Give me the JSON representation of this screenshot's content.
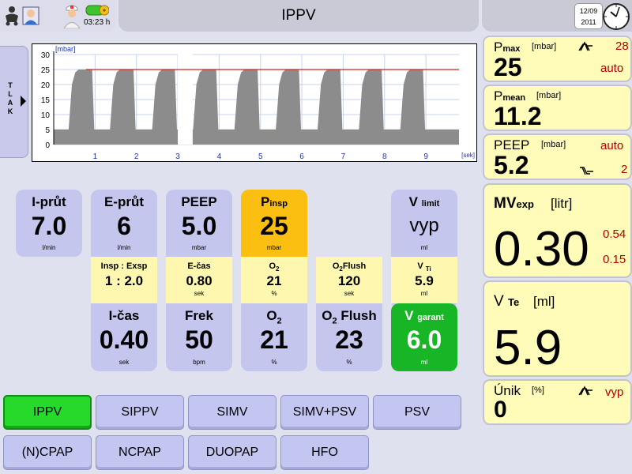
{
  "header": {
    "mode_title": "IPPV",
    "time": "03:23 h",
    "date_line1": "12/09",
    "date_line2": "2011",
    "icons": [
      "baby-icon",
      "nurse-icon",
      "doctor-icon",
      "battery-icon",
      "clock-icon"
    ]
  },
  "side_tab": {
    "letters": [
      "T",
      "L",
      "A",
      "K"
    ],
    "arrow": "arrow-right-icon"
  },
  "chart_data": {
    "type": "area",
    "ylabel": "[mbar]",
    "xlabel": "[sek]",
    "yticks": [
      "0",
      "5",
      "10",
      "15",
      "20",
      "25",
      "30"
    ],
    "xticks": [
      "1",
      "2",
      "3",
      "4",
      "5",
      "6",
      "7",
      "8",
      "9"
    ],
    "ylim": [
      0,
      30
    ],
    "xlim": [
      0,
      9.8
    ],
    "limit_line": 25,
    "grid": true,
    "baseline": 5,
    "peak": 25,
    "breath_starts": [
      0.36,
      1.36,
      2.38,
      3.37,
      4.37,
      5.37,
      6.38,
      7.38,
      8.38
    ],
    "breath_ends": [
      0.98,
      1.98,
      2.98,
      3.98,
      4.98,
      5.98,
      6.98,
      7.98,
      8.98
    ],
    "gap": [
      3.0,
      3.36
    ],
    "fill_color": "#8c8c8c",
    "limit_color": "#d42020"
  },
  "right_panels": {
    "pmax": {
      "label": "P",
      "sub": "max",
      "unit": "[mbar]",
      "value": "25",
      "limit": "28",
      "mode": "auto",
      "icon": "pressure-limit-icon"
    },
    "pmean": {
      "label": "P",
      "sub": "mean",
      "unit": "[mbar]",
      "value": "11.2"
    },
    "peep": {
      "label": "PEEP",
      "unit": "[mbar]",
      "value": "5.2",
      "mode": "auto",
      "limit": "2",
      "icon": "peep-limit-icon"
    },
    "mvexp": {
      "label": "MV",
      "sub": "exp",
      "unit": "[litr]",
      "value": "0.30",
      "upper": "0.54",
      "lower": "0.15"
    },
    "vte": {
      "label": "V",
      "sub": "Te",
      "unit": "[ml]",
      "value": "5.9"
    },
    "unik": {
      "label": "Únik",
      "unit": "[%]",
      "value": "0",
      "mode": "vyp",
      "icon": "leak-limit-icon"
    }
  },
  "params": {
    "iprut": {
      "label": "I-průt",
      "value": "7.0",
      "unit": "l/min"
    },
    "eprut": {
      "label": "E-průt",
      "value": "6",
      "unit": "l/min"
    },
    "peep": {
      "label": "PEEP",
      "value": "5.0",
      "unit": "mbar"
    },
    "pinsp": {
      "label": "P",
      "sub": "insp",
      "value": "25",
      "unit": "mbar"
    },
    "vlimit": {
      "label": "V",
      "sub": "limit",
      "value": "vyp",
      "unit": "ml"
    },
    "inspexsp": {
      "label": "Insp : Exsp",
      "value": "1 : 2.0"
    },
    "ecas": {
      "label": "E-čas",
      "value": "0.80",
      "unit": "sek"
    },
    "o2mid": {
      "label": "O",
      "sub": "2",
      "value": "21",
      "unit": "%"
    },
    "o2flushmid": {
      "label": "O",
      "sub": "2",
      "tail": "Flush",
      "value": "120",
      "unit": "sek"
    },
    "vti": {
      "label": "V",
      "sub": "Ti",
      "value": "5.9",
      "unit": "ml"
    },
    "icas": {
      "label": "I-čas",
      "value": "0.40",
      "unit": "sek"
    },
    "frek": {
      "label": "Frek",
      "value": "50",
      "unit": "bpm"
    },
    "o2": {
      "label": "O",
      "sub": "2",
      "value": "21",
      "unit": "%"
    },
    "o2flush": {
      "label": "O",
      "sub": "2",
      "tail": "Flush",
      "value": "23",
      "unit": "%"
    },
    "vgarant": {
      "label": "V",
      "sub": "garant",
      "value": "6.0",
      "unit": "ml"
    }
  },
  "mode_buttons": [
    {
      "label": "IPPV",
      "active": true
    },
    {
      "label": "SIPPV"
    },
    {
      "label": "SIMV"
    },
    {
      "label": "SIMV+PSV"
    },
    {
      "label": "PSV"
    },
    {
      "label": "(N)CPAP"
    },
    {
      "label": "NCPAP"
    },
    {
      "label": "DUOPAP"
    },
    {
      "label": "HFO"
    }
  ],
  "colors": {
    "tile_blue": "#c4c6ee",
    "tile_yellow": "#fdf7b0",
    "pinsp_orange": "#fbbf12",
    "vgarant_green": "#18b626",
    "active_green": "#26d92a",
    "alarm_red": "#b50000"
  }
}
